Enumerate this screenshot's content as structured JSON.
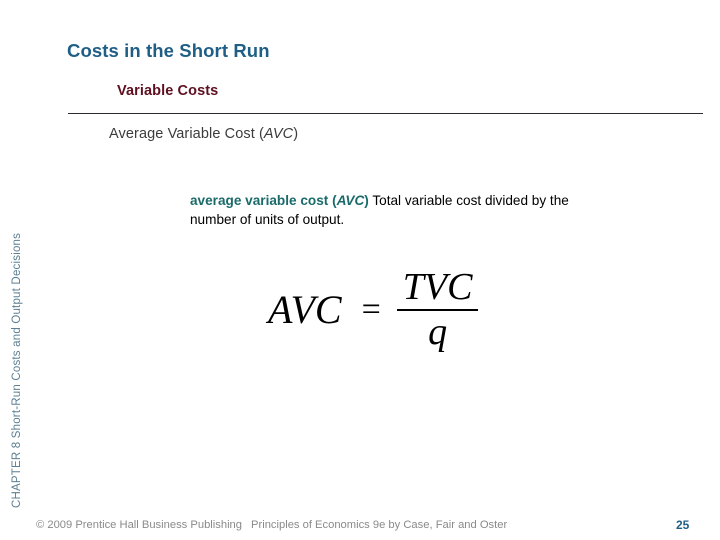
{
  "slide": {
    "title": "Costs in the Short Run",
    "section_heading": "Variable Costs",
    "subsection_heading_main": "Average Variable Cost (",
    "subsection_heading_italic": "AVC",
    "subsection_heading_tail": ")",
    "number": "25"
  },
  "sidebar": {
    "chapter_label": "CHAPTER 8  Short-Run Costs and Output Decisions"
  },
  "definition": {
    "term_main": "average variable cost (",
    "term_italic": "AVC",
    "term_tail": ")",
    "text": " Total variable cost divided by the number of units of output."
  },
  "equation": {
    "lhs": "AVC",
    "operator": "=",
    "numerator": "TVC",
    "denominator": "q"
  },
  "footer": {
    "copyright": "© 2009 Prentice Hall Business Publishing",
    "book": "Principles of Economics 9e by Case, Fair and Oster"
  },
  "colors": {
    "title": "#1f5f86",
    "section_heading": "#5e1020",
    "subsection_heading": "#3c3c3c",
    "term": "#1a6a6a",
    "sidebar": "#5b7f93",
    "footer": "#8a8a8a",
    "divider": "#2b2b33",
    "slide_number": "#1f5f86",
    "background": "#ffffff"
  }
}
